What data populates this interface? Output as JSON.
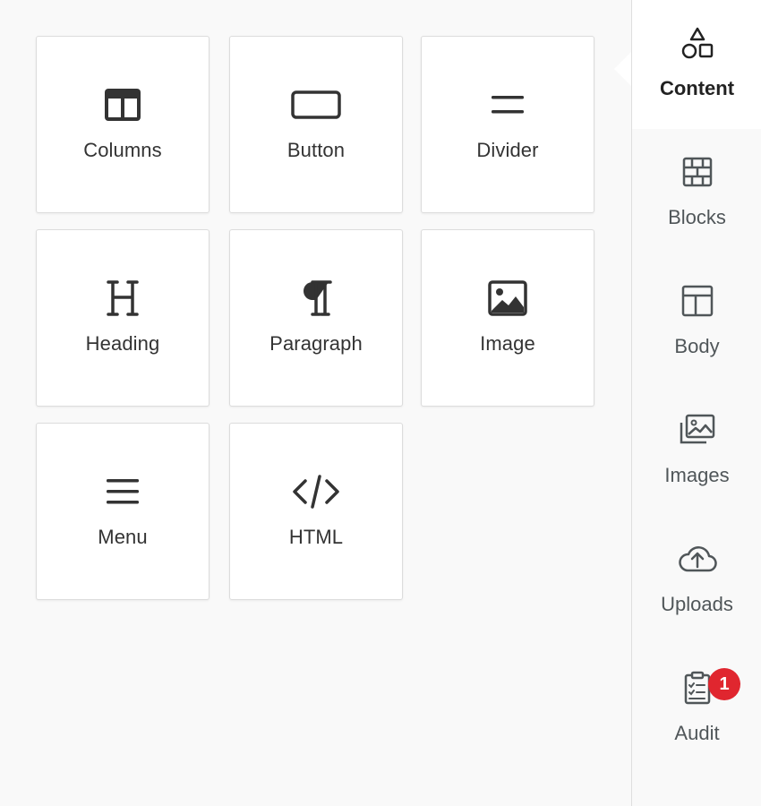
{
  "tools": [
    {
      "label": "Columns",
      "icon": "columns-icon"
    },
    {
      "label": "Button",
      "icon": "button-icon"
    },
    {
      "label": "Divider",
      "icon": "divider-icon"
    },
    {
      "label": "Heading",
      "icon": "heading-icon"
    },
    {
      "label": "Paragraph",
      "icon": "paragraph-icon"
    },
    {
      "label": "Image",
      "icon": "image-icon"
    },
    {
      "label": "Menu",
      "icon": "menu-icon"
    },
    {
      "label": "HTML",
      "icon": "code-icon"
    }
  ],
  "sidebar": {
    "active_tab": "Content",
    "tabs": [
      {
        "label": "Content",
        "icon": "shapes-icon"
      },
      {
        "label": "Blocks",
        "icon": "brick-wall-icon"
      },
      {
        "label": "Body",
        "icon": "layout-icon"
      },
      {
        "label": "Images",
        "icon": "images-icon"
      },
      {
        "label": "Uploads",
        "icon": "cloud-upload-icon"
      },
      {
        "label": "Audit",
        "icon": "clipboard-check-icon",
        "badge": "1"
      }
    ]
  },
  "colors": {
    "badge": "#e0262f",
    "icon": "#333333",
    "rail_icon": "#505659"
  }
}
